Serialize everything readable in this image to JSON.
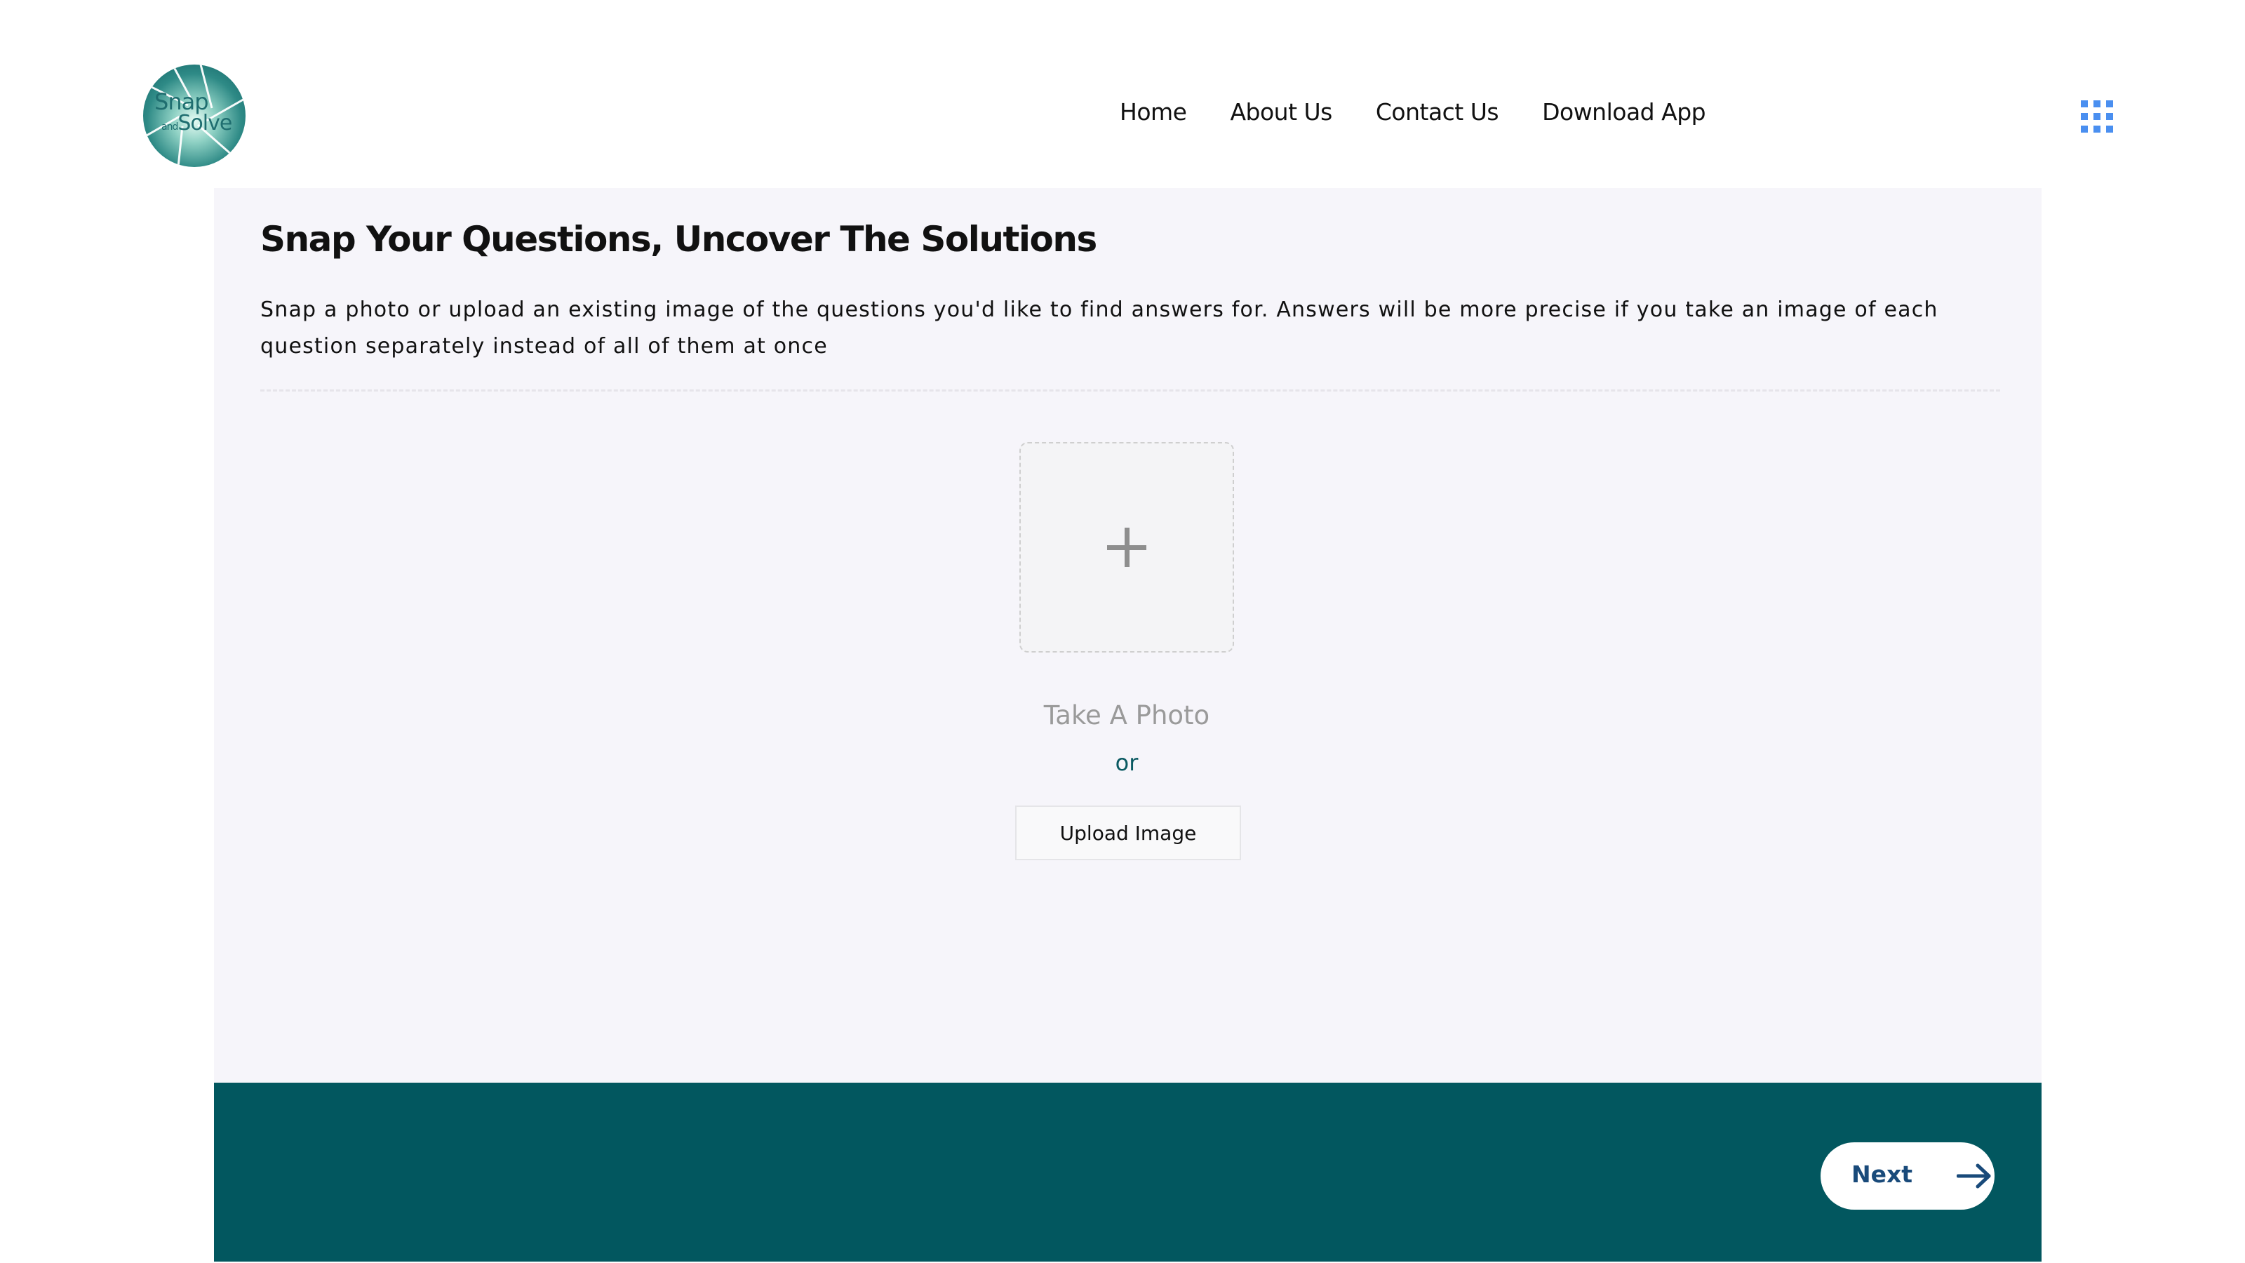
{
  "brand": {
    "name": "Snap and Solve",
    "logo_line1": "Snap",
    "logo_small": "and",
    "logo_line2": "Solve"
  },
  "nav": {
    "items": [
      {
        "label": "Home"
      },
      {
        "label": "About Us"
      },
      {
        "label": "Contact Us"
      },
      {
        "label": "Download App"
      }
    ],
    "menu_icon": "grid-icon"
  },
  "main": {
    "title": "Snap Your Questions, Uncover The Solutions",
    "description": "Snap a photo or upload an existing image of the questions you'd like to find answers for. Answers will be more precise if you take an image of each question separately instead of all of them at once",
    "dropzone_icon": "plus-icon",
    "take_photo_label": "Take A Photo",
    "or_label": "or",
    "upload_label": "Upload Image"
  },
  "footer": {
    "next_label": "Next",
    "next_icon": "arrow-right-icon"
  },
  "colors": {
    "teal": "#02575f",
    "card_bg": "#f6f5fa",
    "nav_accent": "#4a8ff0",
    "next_text": "#194a7a"
  }
}
